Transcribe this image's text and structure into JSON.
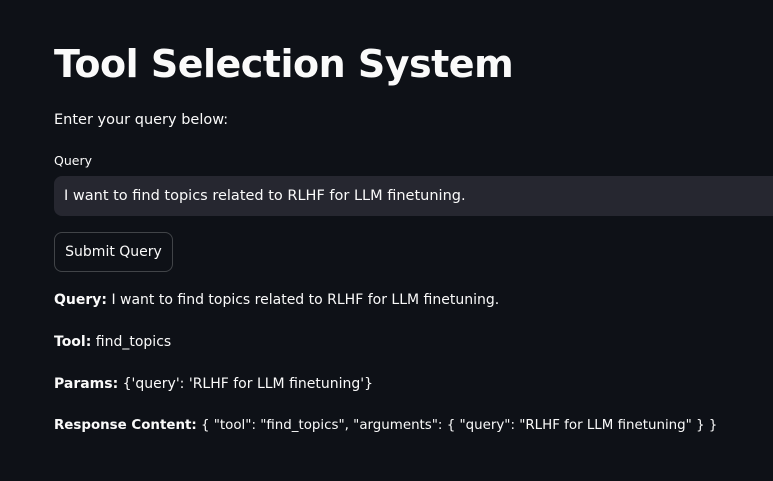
{
  "page": {
    "title": "Tool Selection System",
    "intro": "Enter your query below:"
  },
  "form": {
    "label": "Query",
    "value": "I want to find topics related to RLHF for LLM finetuning.",
    "submit_label": "Submit Query"
  },
  "results": {
    "query_label": "Query:",
    "query_value": " I want to find topics related to RLHF for LLM finetuning.",
    "tool_label": "Tool:",
    "tool_value": " find_topics",
    "params_label": "Params:",
    "params_value": " {'query': 'RLHF for LLM finetuning'}",
    "response_label": "Response Content:",
    "response_value": " { \"tool\": \"find_topics\", \"arguments\": { \"query\": \"RLHF for LLM finetuning\" } }"
  },
  "colors": {
    "background": "#0e1117",
    "input_background": "#262730",
    "text": "#fafafa"
  }
}
